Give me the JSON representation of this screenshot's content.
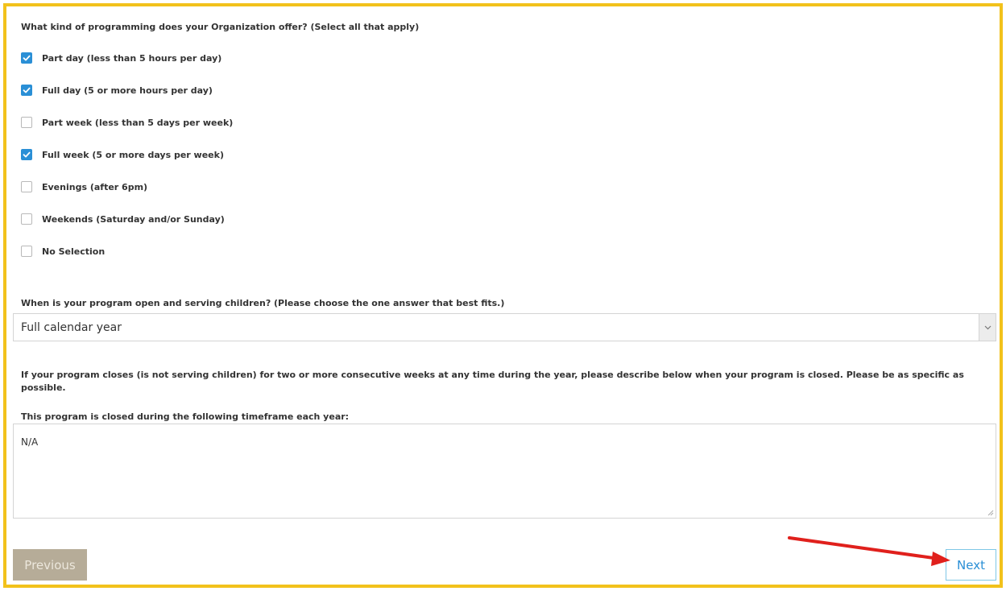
{
  "question_programming": "What kind of programming does your Organization offer? (Select all that apply)",
  "options": [
    {
      "label": "Part day (less than 5 hours per day)",
      "checked": true
    },
    {
      "label": "Full day (5 or more hours per day)",
      "checked": true
    },
    {
      "label": "Part week (less than 5 days per week)",
      "checked": false
    },
    {
      "label": "Full week (5 or more days per week)",
      "checked": true
    },
    {
      "label": "Evenings (after 6pm)",
      "checked": false
    },
    {
      "label": "Weekends (Saturday and/or Sunday)",
      "checked": false
    },
    {
      "label": "No Selection",
      "checked": false
    }
  ],
  "question_open": "When is your program open and serving children? (Please choose the one answer that best fits.)",
  "open_select": {
    "value": "Full calendar year"
  },
  "question_closes": "If your program closes (is not serving children) for two or more consecutive weeks at any time during the year, please describe below when your program is closed. Please be as specific as possible.",
  "closed_label": "This program is closed during the following timeframe each year:",
  "closed_text": "N/A",
  "nav": {
    "previous_label": "Previous",
    "next_label": "Next"
  },
  "colors": {
    "frame_border": "#f2c21b",
    "checkbox_checked": "#2a8fd6",
    "previous_bg": "#b6ac98",
    "next_text": "#2a8fd6",
    "annotation_arrow": "#e0201c"
  },
  "icons": {
    "check": "check-icon",
    "dropdown": "chevron-down-icon",
    "resize": "resize-handle-icon",
    "annotation": "red-arrow-icon"
  }
}
